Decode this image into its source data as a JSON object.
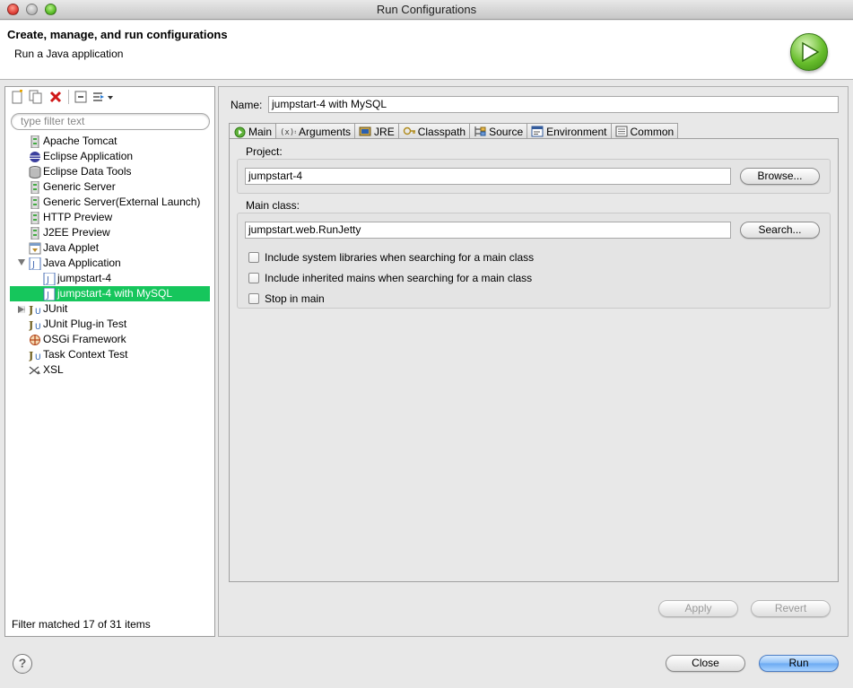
{
  "window": {
    "title": "Run Configurations"
  },
  "header": {
    "title": "Create, manage, and run configurations",
    "subtitle": "Run a Java application"
  },
  "left_panel": {
    "filter_placeholder": "type filter text",
    "toolbar_icons": [
      "new-config-icon",
      "duplicate-icon",
      "delete-icon",
      "collapse-all-icon",
      "filter-icon"
    ],
    "tree": [
      {
        "label": "Apache Tomcat",
        "icon": "server-icon",
        "level": 0
      },
      {
        "label": "Eclipse Application",
        "icon": "eclipse-icon",
        "level": 0
      },
      {
        "label": "Eclipse Data Tools",
        "icon": "database-icon",
        "level": 0
      },
      {
        "label": "Generic Server",
        "icon": "server-icon",
        "level": 0
      },
      {
        "label": "Generic Server(External Launch)",
        "icon": "server-icon",
        "level": 0
      },
      {
        "label": "HTTP Preview",
        "icon": "server-icon",
        "level": 0
      },
      {
        "label": "J2EE Preview",
        "icon": "server-icon",
        "level": 0
      },
      {
        "label": "Java Applet",
        "icon": "applet-icon",
        "level": 0
      },
      {
        "label": "Java Application",
        "icon": "java-app-icon",
        "level": 0,
        "expanded": true
      },
      {
        "label": "jumpstart-4",
        "icon": "java-app-icon",
        "level": 1
      },
      {
        "label": "jumpstart-4 with MySQL",
        "icon": "java-app-icon",
        "level": 1,
        "selected": true
      },
      {
        "label": "JUnit",
        "icon": "junit-icon",
        "level": 0,
        "collapsed": true
      },
      {
        "label": "JUnit Plug-in Test",
        "icon": "junit-plugin-icon",
        "level": 0
      },
      {
        "label": "OSGi Framework",
        "icon": "osgi-icon",
        "level": 0
      },
      {
        "label": "Task Context Test",
        "icon": "junit-task-icon",
        "level": 0
      },
      {
        "label": "XSL",
        "icon": "xsl-icon",
        "level": 0
      }
    ],
    "status": "Filter matched 17 of 31 items"
  },
  "right_panel": {
    "name_label": "Name:",
    "name_value": "jumpstart-4 with MySQL",
    "tabs": [
      {
        "label": "Main",
        "icon": "main-tab-icon",
        "active": true
      },
      {
        "label": "Arguments",
        "icon": "arguments-icon"
      },
      {
        "label": "JRE",
        "icon": "jre-icon"
      },
      {
        "label": "Classpath",
        "icon": "classpath-icon"
      },
      {
        "label": "Source",
        "icon": "source-icon"
      },
      {
        "label": "Environment",
        "icon": "environment-icon"
      },
      {
        "label": "Common",
        "icon": "common-icon"
      }
    ],
    "project": {
      "label": "Project:",
      "value": "jumpstart-4",
      "browse_button": "Browse..."
    },
    "main_class": {
      "label": "Main class:",
      "value": "jumpstart.web.RunJetty",
      "search_button": "Search...",
      "options": [
        {
          "label": "Include system libraries when searching for a main class",
          "checked": false
        },
        {
          "label": "Include inherited mains when searching for a main class",
          "checked": false
        },
        {
          "label": "Stop in main",
          "checked": false
        }
      ]
    },
    "apply_button": "Apply",
    "revert_button": "Revert"
  },
  "footer": {
    "help_icon": "?",
    "close_button": "Close",
    "run_button": "Run"
  },
  "colors": {
    "selection": "#16c65c",
    "run_accent": "#67bd2c"
  }
}
